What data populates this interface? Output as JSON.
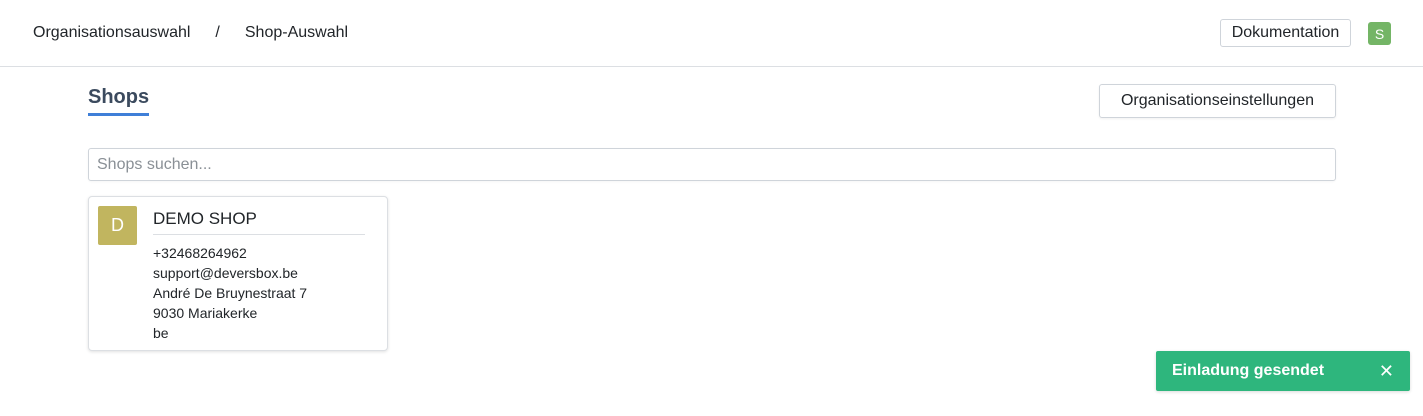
{
  "header": {
    "breadcrumb": {
      "organisation": "Organisationsauswahl",
      "separator": "/",
      "shop": "Shop-Auswahl"
    },
    "documentation_label": "Dokumentation",
    "user_initial": "S"
  },
  "main": {
    "title": "Shops",
    "org_settings_label": "Organisationseinstellungen",
    "search": {
      "placeholder": "Shops suchen...",
      "value": ""
    },
    "shops": [
      {
        "initial": "D",
        "name": "DEMO SHOP",
        "phone": "+32468264962",
        "email": "support@deversbox.be",
        "street": "André De Bruynestraat 7",
        "city": "9030 Mariakerke",
        "country": "be"
      }
    ]
  },
  "toast": {
    "message": "Einladung gesendet",
    "close_symbol": "✕"
  },
  "colors": {
    "accent_underline": "#3f7fd8",
    "user_avatar": "#74b566",
    "shop_avatar": "#c1b55f",
    "toast_success": "#2eb67d"
  }
}
